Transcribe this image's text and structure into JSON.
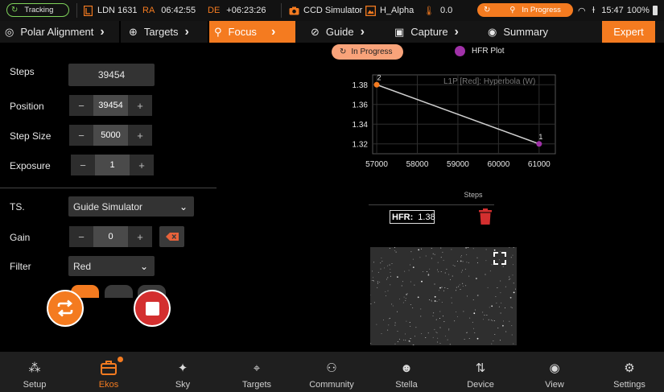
{
  "status_bar": {
    "tracking": "Tracking",
    "target": "LDN 1631",
    "ra_label": "RA",
    "ra_value": "06:42:55",
    "de_label": "DE",
    "de_value": "+06:23:26",
    "camera": "CCD Simulator",
    "filter": "H_Alpha",
    "temperature": "0.0",
    "focus_state": "In Progress",
    "time": "15:47",
    "battery": "100%"
  },
  "tabs": [
    {
      "label": "Polar Alignment",
      "icon": "target-crosshair-icon"
    },
    {
      "label": "Targets",
      "icon": "globe-icon"
    },
    {
      "label": "Focus",
      "icon": "search-icon",
      "active": true
    },
    {
      "label": "Guide",
      "icon": "compass-icon"
    },
    {
      "label": "Capture",
      "icon": "camera-icon"
    },
    {
      "label": "Summary",
      "icon": "radio-circle-icon"
    }
  ],
  "expert_label": "Expert",
  "form": {
    "steps_label": "Steps",
    "steps_value": "39454",
    "position_label": "Position",
    "position_value": "39454",
    "stepsize_label": "Step Size",
    "stepsize_value": "5000",
    "exposure_label": "Exposure",
    "exposure_value": "1",
    "ts_label": "TS.",
    "ts_value": "Guide Simulator",
    "gain_label": "Gain",
    "gain_value": "0",
    "filter_label": "Filter",
    "filter_value": "Red",
    "minus": "−",
    "plus": "+"
  },
  "focus_panel": {
    "status_label": "In Progress",
    "legend_label": "HFR Plot",
    "hfr_label": "HFR:",
    "hfr_value": "1.38"
  },
  "chart_data": {
    "type": "line",
    "annotation": "L1P [Red]: Hyperbola (W)",
    "xlabel": "Steps",
    "ylabel": "",
    "xlim": [
      56900,
      61400
    ],
    "ylim": [
      1.31,
      1.39
    ],
    "x_ticks": [
      "57000",
      "58000",
      "59000",
      "60000",
      "61000"
    ],
    "y_ticks": [
      "1.32",
      "1.34",
      "1.36",
      "1.38"
    ],
    "points": [
      {
        "x": 57000,
        "y": 1.38,
        "label": "2",
        "color": "#f47b20"
      },
      {
        "x": 61000,
        "y": 1.32,
        "label": "1",
        "color": "#a031a8"
      }
    ],
    "line_color": "#cfcfcf",
    "grid": true
  },
  "bottom_nav": [
    {
      "label": "Setup",
      "icon": "network-icon"
    },
    {
      "label": "Ekos",
      "icon": "ekos-icon",
      "active": true
    },
    {
      "label": "Sky",
      "icon": "sparkle-icon"
    },
    {
      "label": "Targets",
      "icon": "crosshair-icon"
    },
    {
      "label": "Community",
      "icon": "people-icon"
    },
    {
      "label": "Stella",
      "icon": "head-icon"
    },
    {
      "label": "Device",
      "icon": "transfer-arrows-icon"
    },
    {
      "label": "View",
      "icon": "eye-icon"
    },
    {
      "label": "Settings",
      "icon": "gear-icon"
    }
  ],
  "colors": {
    "accent": "#f47b20",
    "tracking_green": "#7fd35a",
    "hfr_purple": "#a031a8",
    "stop_red": "#d32f2f"
  }
}
